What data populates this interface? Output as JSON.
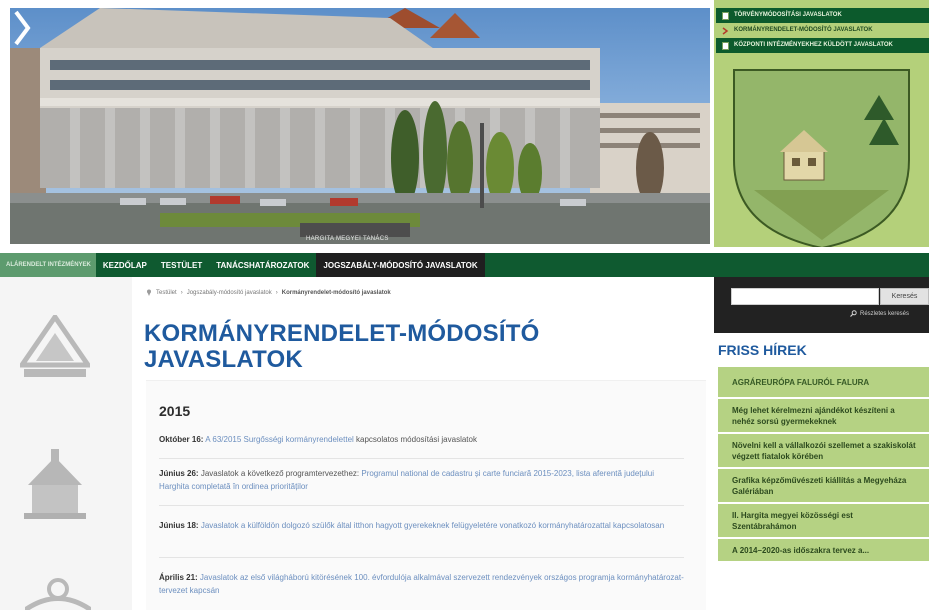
{
  "hero": {
    "caption": "HARGITA MEGYEI TANÁCS",
    "links": [
      {
        "label": "TÖRVÉNYMÓDOSÍTÁSI JAVASLATOK"
      },
      {
        "label": "KORMÁNYRENDELET-MÓDOSÍTÓ JAVASLATOK"
      },
      {
        "label": "KÖZPONTI INTÉZMÉNYEKHEZ KÜLDÖTT JAVASLATOK"
      }
    ]
  },
  "nav": {
    "items": [
      {
        "label": "ALÁRENDELT INTÉZMÉNYEK"
      },
      {
        "label": "KEZDŐLAP"
      },
      {
        "label": "TESTÜLET"
      },
      {
        "label": "TANÁCSHATÁROZATOK"
      },
      {
        "label": "JOGSZABÁLY-MÓDOSÍTÓ JAVASLATOK"
      }
    ]
  },
  "breadcrumb": {
    "items": [
      "Testület",
      "Jogszabály-módosító javaslatok",
      "Kormányrendelet-módosító javaslatok"
    ],
    "separator": "›"
  },
  "page_title": "KORMÁNYRENDELET-MÓDOSÍTÓ JAVASLATOK",
  "content": {
    "year": "2015",
    "entries": [
      {
        "date": "Október 16:",
        "link": "A 63/2015 Surgősségi kormányrendelettel",
        "text": "kapcsolatos módosítási javaslatok"
      },
      {
        "date": "Június 26:",
        "text": "Javaslatok a következő programtervezethez:",
        "link": "Programul national de cadastru și carte funciară 2015-2023, lista aferentă județului Harghita completată în ordinea priorităților"
      },
      {
        "date": "Június 18:",
        "text": "Javaslatok a külföldön dolgozó szülők által itthon hagyott gyerekeknek felügyeletére vonatkozó kormányhatározattal kapcsolatosan"
      },
      {
        "date": "Április 21:",
        "text": "Javaslatok az első világháború kitörésének 100. évfordulója alkalmával szervezett rendezvények országos programja kormányhatározat-tervezet kapcsán"
      }
    ]
  },
  "search": {
    "placeholder": "",
    "button_label": "Keresés",
    "advanced_label": "Részletes keresés"
  },
  "news": {
    "title": "FRISS HÍREK",
    "items": [
      {
        "label": "AGRÁREURÓPA FALURÓL FALURA"
      },
      {
        "label": "Még lehet kérelmezni ajándékot készíteni a nehéz sorsú gyermekeknek"
      },
      {
        "label": "Növelni kell a vállalkozói szellemet a szakiskolát végzett fiatalok körében"
      },
      {
        "label": "Grafika képzőművészeti kiállítás a Megyeháza Galériában"
      },
      {
        "label": "II. Hargita megyei közösségi est Szentábrahámon"
      },
      {
        "label": "A 2014–2020-as időszakra tervez a..."
      }
    ]
  },
  "colors": {
    "nav_green": "#0f5a30",
    "title_blue": "#1f5a9e",
    "panel_green": "#b4d07a",
    "news_green": "#b5d283",
    "link_blue": "#6c8fbf"
  },
  "icons": [
    "document-icon",
    "arrow-right-icon",
    "pin-icon",
    "search-icon",
    "chevron-right-icon"
  ]
}
